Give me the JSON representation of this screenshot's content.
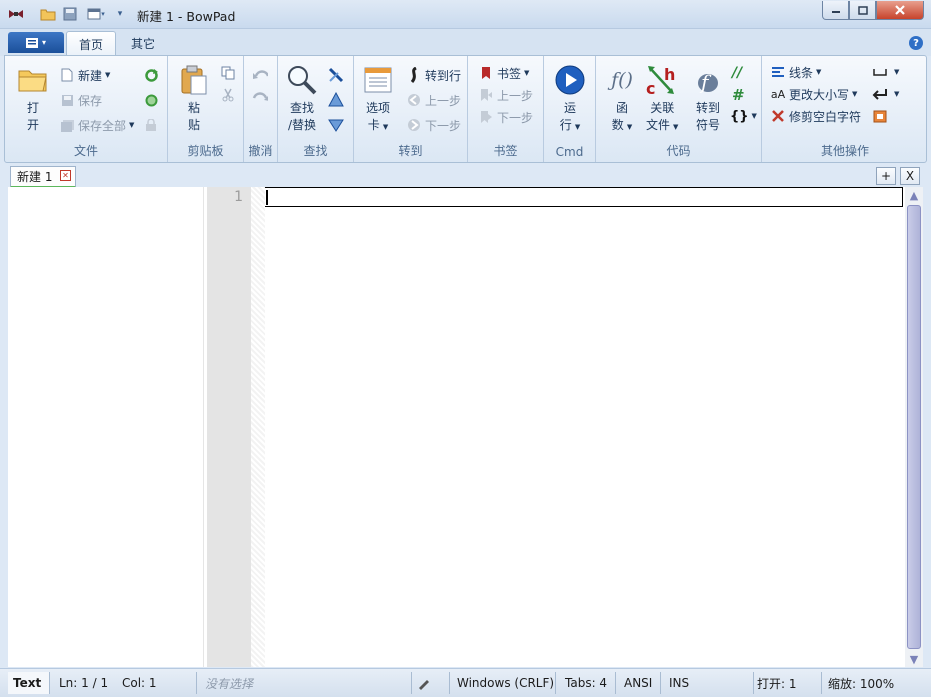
{
  "title_bar": {
    "title": "新建 1 - BowPad",
    "quick_access": [
      "app-icon",
      "open-folder-icon",
      "save-icon",
      "window-icon",
      "dropdown-icon"
    ],
    "controls": [
      "minimize",
      "maximize",
      "close"
    ]
  },
  "ribbon_tabs": {
    "app_menu": "▤ ▾",
    "tabs": [
      "首页",
      "其它"
    ],
    "active": "首页",
    "help": "?"
  },
  "groups": {
    "file": {
      "label": "文件",
      "open": "打\n开",
      "open_l1": "打",
      "open_l2": "开",
      "new": "新建",
      "save": "保存",
      "save_all": "保存全部"
    },
    "clipboard": {
      "label": "剪贴板",
      "paste_l1": "粘",
      "paste_l2": "贴"
    },
    "undo": {
      "label": "撤消"
    },
    "find": {
      "label": "查找",
      "find_l1": "查找",
      "find_l2": "/替换"
    },
    "goto": {
      "label": "转到",
      "tabs_l1": "选项",
      "tabs_l2": "卡",
      "goto_line": "转到行",
      "prev": "上一步",
      "next": "下一步"
    },
    "bookmarks": {
      "label": "书签",
      "bookmarks": "书签",
      "prev": "上一步",
      "next": "下一步"
    },
    "cmd": {
      "label": "Cmd",
      "run_l1": "运",
      "run_l2": "行"
    },
    "code": {
      "label": "代码",
      "func_l1": "函",
      "func_l2": "数",
      "related_l1": "关联",
      "related_l2": "文件",
      "goto_sym_l1": "转到",
      "goto_sym_l2": "符号"
    },
    "other": {
      "label": "其他操作",
      "lines": "线条",
      "case": "更改大小写",
      "trim": "修剪空白字符"
    }
  },
  "doc_tab": {
    "name": "新建 1",
    "add": "+",
    "close_all": "X"
  },
  "editor": {
    "line_number": "1"
  },
  "status_bar": {
    "lexer": "Text",
    "line": "Ln: 1 / 1",
    "col": "Col: 1",
    "selection": "没有选择",
    "eol": "Windows (CRLF)",
    "tabs": "Tabs: 4",
    "encoding": "ANSI",
    "mode": "INS",
    "open": "打开: 1",
    "zoom": "缩放: 100%"
  },
  "colors": {
    "accent": "#1b4f9a",
    "ribbon_bg": "#dbe7f4",
    "doc_tab_underline": "#5cb85c"
  }
}
